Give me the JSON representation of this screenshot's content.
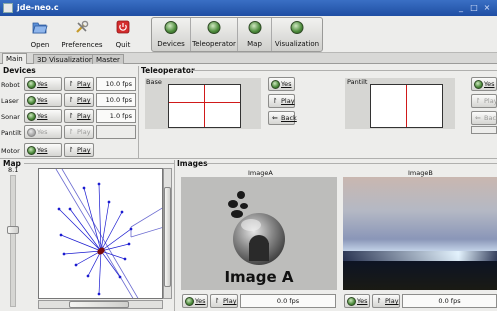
{
  "window": {
    "title": "jde-neo.c",
    "controls": [
      "_",
      "□",
      "×"
    ]
  },
  "toolbar": {
    "open_label": "Open",
    "preferences_label": "Preferences",
    "quit_label": "Quit",
    "components": [
      {
        "label": "Devices"
      },
      {
        "label": "Teleoperator"
      },
      {
        "label": "Map"
      },
      {
        "label": "Visualization"
      }
    ]
  },
  "tabs": [
    {
      "label": "Main"
    },
    {
      "label": "3D Visualization"
    },
    {
      "label": "Master"
    }
  ],
  "devices": {
    "title": "Devices",
    "rows": [
      {
        "name": "Robot",
        "yes": "Yes",
        "play": "Play",
        "fps": "10.0 fps",
        "enabled": true
      },
      {
        "name": "Laser",
        "yes": "Yes",
        "play": "Play",
        "fps": "10.0 fps",
        "enabled": true
      },
      {
        "name": "Sonar",
        "yes": "Yes",
        "play": "Play",
        "fps": "1.0 fps",
        "enabled": true
      },
      {
        "name": "Pantilt",
        "yes": "Yes",
        "play": "Play",
        "fps": "",
        "enabled": false
      },
      {
        "name": "Motor",
        "yes": "Yes",
        "play": "Play",
        "fps": "",
        "enabled": true
      }
    ]
  },
  "teleoperator": {
    "title": "Teleoperator",
    "base_label": "Base",
    "pantilt_label": "Pantilt",
    "yes": "Yes",
    "play": "Play",
    "back": "Back"
  },
  "map": {
    "title": "Map",
    "zoom_value": "8.1"
  },
  "images": {
    "title": "Images",
    "left": {
      "label": "ImageA",
      "caption": "Image A",
      "yes": "Yes",
      "play": "Play",
      "fps": "0.0 fps"
    },
    "right": {
      "label": "ImageB",
      "yes": "Yes",
      "play": "Play",
      "fps": "0.0 fps"
    }
  },
  "colors": {
    "titlebar": "#2a5cb5",
    "led_green": "#4b8a3a",
    "crosshair": "#d01a1a",
    "laser_ray": "#1a1ad0"
  }
}
